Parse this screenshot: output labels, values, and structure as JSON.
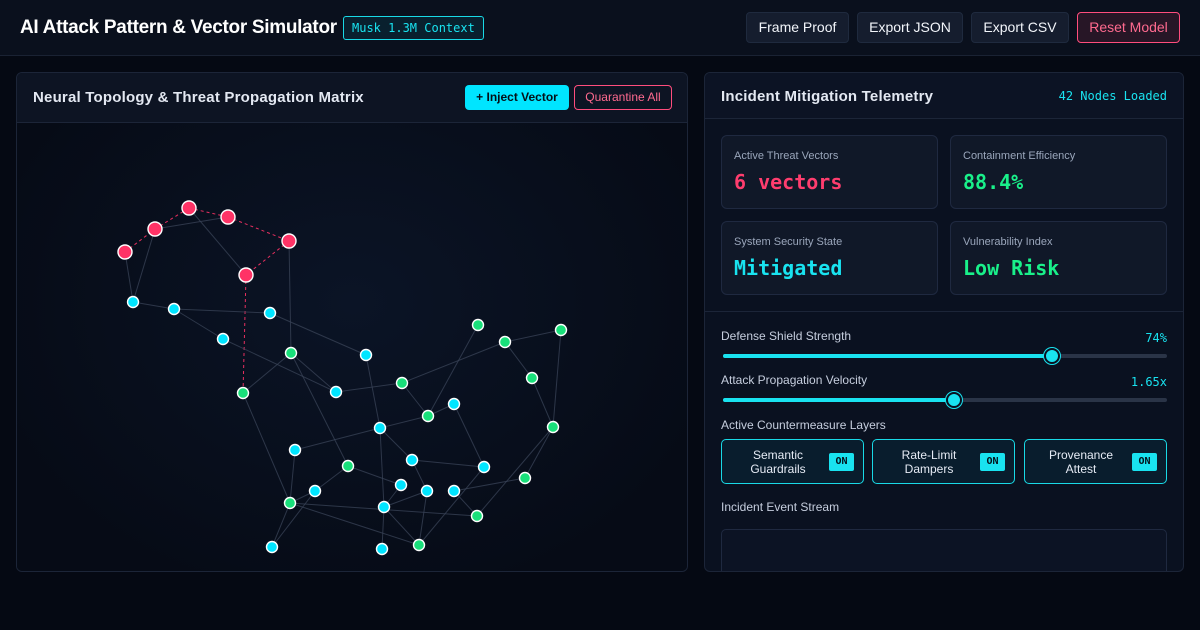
{
  "header": {
    "title": "AI Attack Pattern & Vector Simulator",
    "context_badge": "Musk 1.3M Context",
    "buttons": {
      "frame_proof": "Frame Proof",
      "export_json": "Export JSON",
      "export_csv": "Export CSV",
      "reset_model": "Reset Model"
    }
  },
  "topology": {
    "title": "Neural Topology & Threat Propagation Matrix",
    "inject_label": "+ Inject Vector",
    "quarantine_label": "Quarantine All",
    "colors": {
      "threat": "#ff3366",
      "protected": "#00e5ff",
      "secure": "#19e07a",
      "edge": "#3a4458",
      "threat_edge": "#ff3366"
    }
  },
  "telemetry": {
    "title": "Incident Mitigation Telemetry",
    "nodes_loaded": "42 Nodes Loaded",
    "stats": [
      {
        "label": "Active Threat Vectors",
        "value": "6 vectors",
        "color": "#ff3d6e"
      },
      {
        "label": "Containment Efficiency",
        "value": "88.4%",
        "color": "#19f08a"
      },
      {
        "label": "System Security State",
        "value": "Mitigated",
        "color": "#19e3f0"
      },
      {
        "label": "Vulnerability Index",
        "value": "Low Risk",
        "color": "#19f08a"
      }
    ],
    "sliders": [
      {
        "label": "Defense Shield Strength",
        "value_text": "74%",
        "fraction": 0.74
      },
      {
        "label": "Attack Propagation Velocity",
        "value_text": "1.65x",
        "fraction": 0.52
      }
    ],
    "countermeasures_label": "Active Countermeasure Layers",
    "countermeasures": [
      {
        "label": "Semantic Guardrails",
        "state": "ON"
      },
      {
        "label": "Rate-Limit Dampers",
        "state": "ON"
      },
      {
        "label": "Provenance Attest",
        "state": "ON"
      }
    ],
    "event_stream_label": "Incident Event Stream"
  }
}
